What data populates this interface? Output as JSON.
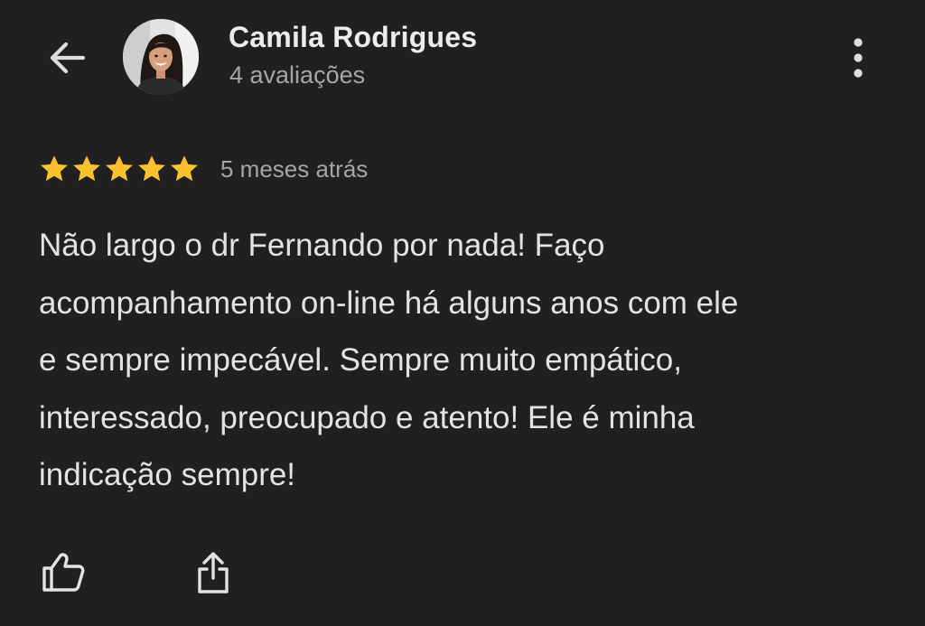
{
  "header": {
    "back_icon": "arrow-left-icon",
    "reviewer_name": "Camila Rodrigues",
    "review_count": "4 avaliações",
    "more_icon": "more-vertical-icon"
  },
  "review": {
    "rating": 5,
    "rating_max": 5,
    "star_color": "#fbc02d",
    "date": "5 meses atrás",
    "text": "Não largo o dr Fernando por nada! Faço\nacompanhamento on-line há alguns anos com ele\ne sempre impecável. Sempre muito empático,\ninteressado, preocupado e atento! Ele é minha\nindicação sempre!"
  },
  "actions": {
    "like_icon": "thumbs-up-icon",
    "share_icon": "share-icon"
  },
  "colors": {
    "background": "#202020",
    "text_primary": "#e3e3e3",
    "text_secondary": "#a6a6a6",
    "icon": "#e3e3e3"
  }
}
